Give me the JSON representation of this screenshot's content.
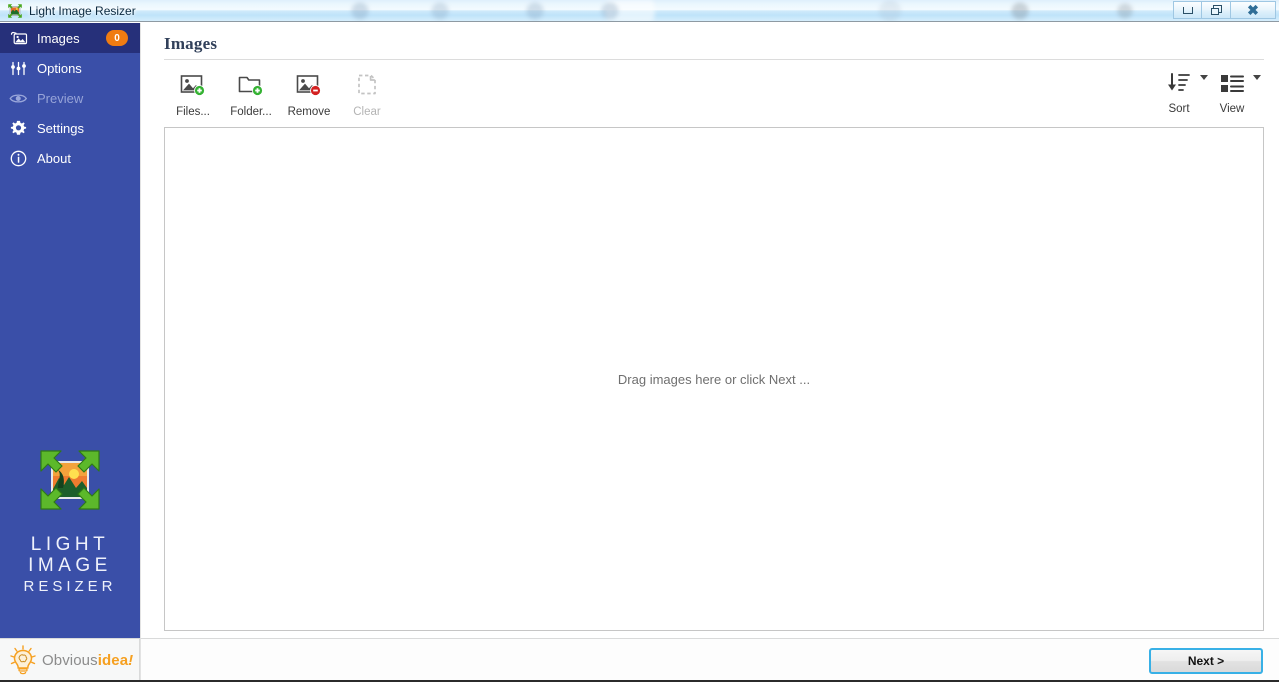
{
  "window": {
    "title": "Light Image Resizer",
    "icon": "app-logo-icon",
    "buttons": {
      "minimize": "minimize",
      "restore": "restore",
      "close": "close"
    }
  },
  "sidebar": {
    "items": [
      {
        "label": "Images",
        "icon": "images-icon",
        "badge": "0",
        "state": "selected"
      },
      {
        "label": "Options",
        "icon": "sliders-icon",
        "badge": "",
        "state": "normal"
      },
      {
        "label": "Preview",
        "icon": "eye-icon",
        "badge": "",
        "state": "disabled"
      },
      {
        "label": "Settings",
        "icon": "gear-icon",
        "badge": "",
        "state": "normal"
      },
      {
        "label": "About",
        "icon": "info-icon",
        "badge": "",
        "state": "normal"
      }
    ],
    "brand": {
      "line1": "LIGHT",
      "line2": "IMAGE",
      "line3": "RESIZER"
    }
  },
  "footer_logo": {
    "part1": "Obvious",
    "part2": "idea",
    "part3": "!"
  },
  "main": {
    "page_title": "Images",
    "toolbar": {
      "tools": [
        {
          "label": "Files...",
          "icon": "add-image-icon",
          "state": "enabled"
        },
        {
          "label": "Folder...",
          "icon": "add-folder-icon",
          "state": "enabled"
        },
        {
          "label": "Remove",
          "icon": "remove-image-icon",
          "state": "enabled"
        },
        {
          "label": "Clear",
          "icon": "clear-page-icon",
          "state": "disabled"
        }
      ],
      "right_tools": [
        {
          "label": "Sort",
          "icon": "sort-descending-icon"
        },
        {
          "label": "View",
          "icon": "list-view-icon"
        }
      ]
    },
    "drop_zone": {
      "text": "Drag images here or click Next ..."
    }
  },
  "bottom": {
    "next_label": "Next >"
  },
  "colors": {
    "sidebar_blue": "#3a4fa8",
    "sidebar_selected": "#26307a",
    "badge_orange": "#f07c12",
    "accent_blue": "#38b0e6",
    "brand_orange": "#f6a020",
    "title_text": "#31405a"
  }
}
